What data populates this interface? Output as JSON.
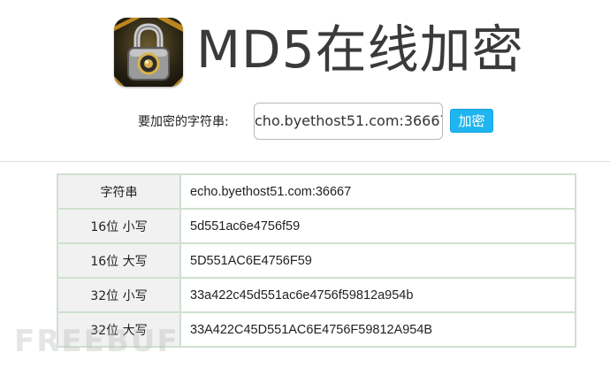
{
  "header": {
    "logo_icon": "padlock-icon",
    "title": "MD5在线加密"
  },
  "form": {
    "label": "要加密的字符串:",
    "input_value": "cho.byethost51.com:36667",
    "submit_label": "加密"
  },
  "results": {
    "rows": [
      {
        "key": "字符串",
        "value": "echo.byethost51.com:36667"
      },
      {
        "key": "16位 小写",
        "value": "5d551ac6e4756f59"
      },
      {
        "key": "16位 大写",
        "value": "5D551AC6E4756F59"
      },
      {
        "key": "32位 小写",
        "value": "33a422c45d551ac6e4756f59812a954b"
      },
      {
        "key": "32位 大写",
        "value": "33A422C45D551AC6E4756F59812A954B"
      }
    ]
  },
  "watermark": "FREEBUF",
  "colors": {
    "button_bg": "#1fb5f0",
    "table_border": "#cfe0cf",
    "key_cell_bg": "#f1f1f1",
    "title_text": "#3a3a3a"
  }
}
